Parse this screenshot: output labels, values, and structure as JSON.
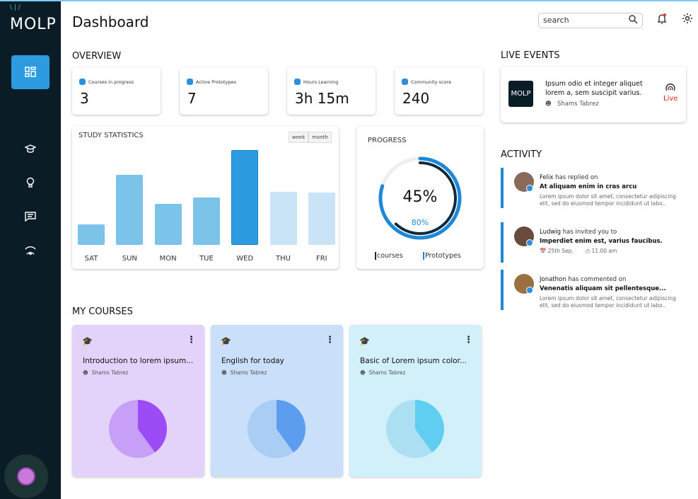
{
  "app": {
    "logo": "MOLP",
    "title": "Dashboard"
  },
  "header": {
    "search_placeholder": "search",
    "notification_dot_color": "#e53935"
  },
  "sidebar": {
    "items": [
      {
        "icon": "dashboard-icon",
        "active": true
      },
      {
        "icon": "graduation-cap-icon"
      },
      {
        "icon": "lightbulb-icon"
      },
      {
        "icon": "chat-icon"
      },
      {
        "icon": "broadcast-icon"
      }
    ]
  },
  "overview": {
    "title": "OVERVIEW",
    "stats": [
      {
        "label": "Courses in progress",
        "value": "3",
        "icon": "courses-icon"
      },
      {
        "label": "Active Prototypes",
        "value": "7",
        "icon": "bulb-icon"
      },
      {
        "label": "Hours Learning",
        "value": "3h 15m",
        "icon": "clock-icon"
      },
      {
        "label": "Community score",
        "value": "240",
        "icon": "flag-icon"
      }
    ]
  },
  "study": {
    "title": "STUDY STATISTICS",
    "toggle": [
      "week",
      "month"
    ]
  },
  "chart_data": [
    {
      "type": "bar",
      "title": "STUDY STATISTICS",
      "categories": [
        "SAT",
        "SUN",
        "MON",
        "TUE",
        "WED",
        "THU",
        "FRI"
      ],
      "values": [
        29,
        99,
        58,
        67,
        134,
        75,
        74
      ],
      "highlight": "WED",
      "colors": {
        "past": "#7cc3ea",
        "current": "#2d9be0",
        "future": "#c9e4f7"
      }
    },
    {
      "type": "pie",
      "values": [
        40,
        60
      ],
      "colors": [
        "#9b4cf5",
        "#c79ff7"
      ]
    },
    {
      "type": "pie",
      "values": [
        40,
        60
      ],
      "colors": [
        "#5d9df0",
        "#a9cdf3"
      ]
    },
    {
      "type": "pie",
      "values": [
        40,
        60
      ],
      "colors": [
        "#60cef0",
        "#addff2"
      ]
    }
  ],
  "progress": {
    "title": "PROGRESS",
    "center": "45%",
    "sub": "80%",
    "courses_fraction": 0.45,
    "prototypes_fraction": 0.8,
    "legend": [
      "courses",
      "Prototypes"
    ],
    "colors": {
      "courses": "#0d2c40",
      "prototypes": "#1e88d8"
    }
  },
  "courses": {
    "title": "MY COURSES",
    "items": [
      {
        "title": "Introduction to lorem ipsum...",
        "author": "Shams Tabrez",
        "bg": "#e3d3fb"
      },
      {
        "title": "English for today",
        "author": "Shams Tabrez",
        "bg": "#cadff9"
      },
      {
        "title": "Basic of Lorem ipsum color...",
        "author": "Shams Tabrez",
        "bg": "#d1f0fa"
      }
    ]
  },
  "live": {
    "title": "LIVE EVENTS",
    "event": {
      "text": "Ipsum odio et integer aliquet lorem a, sem suscipit varius.",
      "author": "Shams Tabrez",
      "status": "Live",
      "thumb": "MOLP"
    }
  },
  "activity": {
    "title": "ACTIVITY",
    "items": [
      {
        "name": "Felix",
        "action": "has replied on",
        "subject": "At aliquam enim in cras arcu",
        "body": "Lorem ipsum dolor sit amet, consectetur adipiscing elit, sed do eiusmod tempor incididunt ut labo.."
      },
      {
        "name": "Ludwig",
        "action": "has invited you to",
        "subject": "Imperdiet enim est, varius faucibus.",
        "date": "25th Sep.",
        "time": "11.00 am"
      },
      {
        "name": "Jonathon",
        "action": "has commented on",
        "subject": "Venenatis aliquam sit pellentesque...",
        "body": "Lorem ipsum dolor sit amet, consectetur adipiscing elit, sed do eiusmod tempor incididunt ut labo.."
      }
    ]
  }
}
